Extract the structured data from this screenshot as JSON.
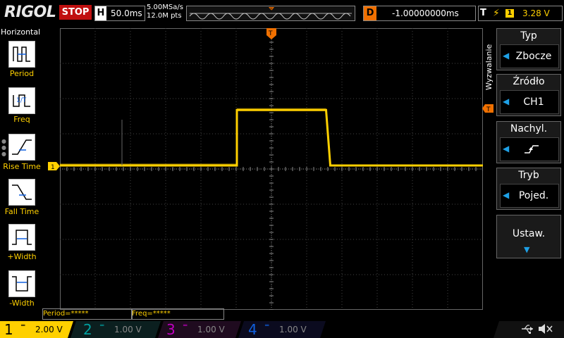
{
  "topbar": {
    "logo": "RIGOL",
    "status": "STOP",
    "timebase_key": "H",
    "timebase": "50.0ms",
    "sample_rate": "5.00MSa/s",
    "memory_depth": "12.0M pts",
    "delay_key": "D",
    "delay": "-1.00000000ms",
    "trigger_key": "T",
    "trigger_channel": "1",
    "trigger_level": "3.28 V"
  },
  "left_menu": {
    "title": "Horizontal",
    "items": [
      {
        "label": "Period",
        "icon": "period-icon"
      },
      {
        "label": "Freq",
        "icon": "frequency-icon"
      },
      {
        "label": "Rise Time",
        "icon": "rise-time-icon"
      },
      {
        "label": "Fall Time",
        "icon": "fall-time-icon"
      },
      {
        "label": "+Width",
        "icon": "positive-width-icon"
      },
      {
        "label": "-Width",
        "icon": "negative-width-icon"
      }
    ]
  },
  "right_menu": {
    "title": "Wyzwalanie",
    "items": [
      {
        "header": "Typ",
        "value": "Zbocze"
      },
      {
        "header": "Źródło",
        "value": "CH1"
      },
      {
        "header": "Nachyl.",
        "value": ""
      },
      {
        "header": "Tryb",
        "value": "Pojed."
      },
      {
        "header": "Ustaw.",
        "value": ""
      }
    ]
  },
  "measurements": {
    "period": "Period=*****",
    "freq": "Freq=*****"
  },
  "channels": [
    {
      "num": "1",
      "scale": "2.00 V",
      "color": "#ffd000",
      "active": true
    },
    {
      "num": "2",
      "scale": "1.00 V",
      "color": "#00a0a0",
      "active": false
    },
    {
      "num": "3",
      "scale": "1.00 V",
      "color": "#c000c0",
      "active": false
    },
    {
      "num": "4",
      "scale": "1.00 V",
      "color": "#1060e0",
      "active": false
    }
  ],
  "colors": {
    "ch1": "#ffd000",
    "trigger": "#f07000",
    "grid": "#444444",
    "accent": "#1ea0e6"
  },
  "waveform": {
    "channel": "1",
    "low_level_div": 0,
    "high_level_div": 1.05,
    "rise_time_div": 5.0,
    "fall_time_div": 7.55
  }
}
